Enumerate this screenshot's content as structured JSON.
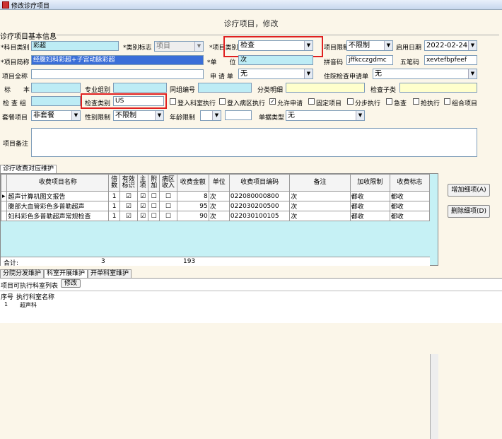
{
  "window": {
    "title": "修改诊疗项目",
    "heading": "诊疗项目，修改"
  },
  "basic": {
    "group_title": "诊疗项目基本信息",
    "item_category_label": "科目类别",
    "item_category_value": "彩超",
    "category_flag_label": "类别标志",
    "category_flag_value": "项目",
    "item_type_label": "项目类别",
    "item_type_value": "检查",
    "limit_label": "项目限制",
    "limit_value": "不限制",
    "start_date_label": "启用日期",
    "start_date_value": "2022-02-24",
    "item_name_label": "项目简称",
    "item_name_value": "经腹妇科彩超+子宫动脉彩超",
    "unit_label": "单　　位",
    "unit_value": "次",
    "pinyin_label": "拼音码",
    "pinyin_value": "jffkcczgdmc",
    "wubi_label": "五笔码",
    "wubi_value": "xevtefbpfeef",
    "item_full_label": "项目全称",
    "item_full_value": "",
    "apply_slip_label": "申 请 单",
    "apply_slip_value": "无",
    "inpatient_label": "住院检查申请单",
    "inpatient_value": "无",
    "standard_label": "标　　本",
    "standard_value": "",
    "specialty_label": "专业组别",
    "specialty_value": "",
    "same_group_label": "同组编号",
    "same_group_value": "",
    "class_detail_label": "分类明细",
    "class_detail_value": "",
    "exam_sub_label": "检查子类",
    "exam_sub_value": "",
    "exam_label": "检 查 组",
    "exam_value": "",
    "exam_type_label": "检查类别",
    "exam_type_value": "US",
    "checks": [
      {
        "label": "登入科室执行",
        "checked": false
      },
      {
        "label": "登入病区执行",
        "checked": false
      },
      {
        "label": "允许申请",
        "checked": true
      },
      {
        "label": "固定项目",
        "checked": false
      },
      {
        "label": "分步执行",
        "checked": false
      },
      {
        "label": "急查",
        "checked": false
      },
      {
        "label": "抢执行",
        "checked": false
      },
      {
        "label": "组合项目",
        "checked": false
      }
    ],
    "package_label": "套餐项目",
    "package_value": "非套餐",
    "gender_label": "性别限制",
    "gender_value": "不限制",
    "age_label": "年龄限制",
    "age_value": "",
    "doc_type_label": "单据类型",
    "doc_type_value": "无",
    "remark_label": "项目备注",
    "remark_value": ""
  },
  "fee": {
    "tab_label": "诊疗收费对应维护",
    "columns": [
      "收费项目名称",
      "倍数",
      "有效标识",
      "主项",
      "附加",
      "病区收入",
      "收费金额",
      "单位",
      "收费项目编码",
      "备注",
      "加收限制",
      "收费标志"
    ],
    "rows": [
      {
        "name": "超声计算机图文报告",
        "mult": "1",
        "valid": true,
        "main": true,
        "add": false,
        "ward": false,
        "amount": "8",
        "unit": "次",
        "code": "022080000800",
        "remark": "次",
        "limit": "都收",
        "flag": "都收"
      },
      {
        "name": "腹部大血管彩色多普勒超声",
        "mult": "1",
        "valid": true,
        "main": true,
        "add": false,
        "ward": false,
        "amount": "95",
        "unit": "次",
        "code": "022030200500",
        "remark": "次",
        "limit": "都收",
        "flag": "都收"
      },
      {
        "name": "妇科彩色多普勒超声常规检查",
        "mult": "1",
        "valid": true,
        "main": true,
        "add": false,
        "ward": false,
        "amount": "90",
        "unit": "次",
        "code": "022030100105",
        "remark": "次",
        "limit": "都收",
        "flag": "都收"
      }
    ],
    "total_label": "合计:",
    "total_mult": "3",
    "total_amount": "193",
    "add_btn": "增加细项(A)",
    "del_btn": "删除细项(D)"
  },
  "bottom": {
    "tabs": [
      "分院分发维护",
      "科室开展维护",
      "开单科室维护"
    ],
    "list_label": "项目可执行科室列表",
    "edit_btn": "修改",
    "columns": [
      "序号",
      "执行科室名称"
    ],
    "rows": [
      {
        "no": "1",
        "dept": "超声科"
      }
    ]
  }
}
